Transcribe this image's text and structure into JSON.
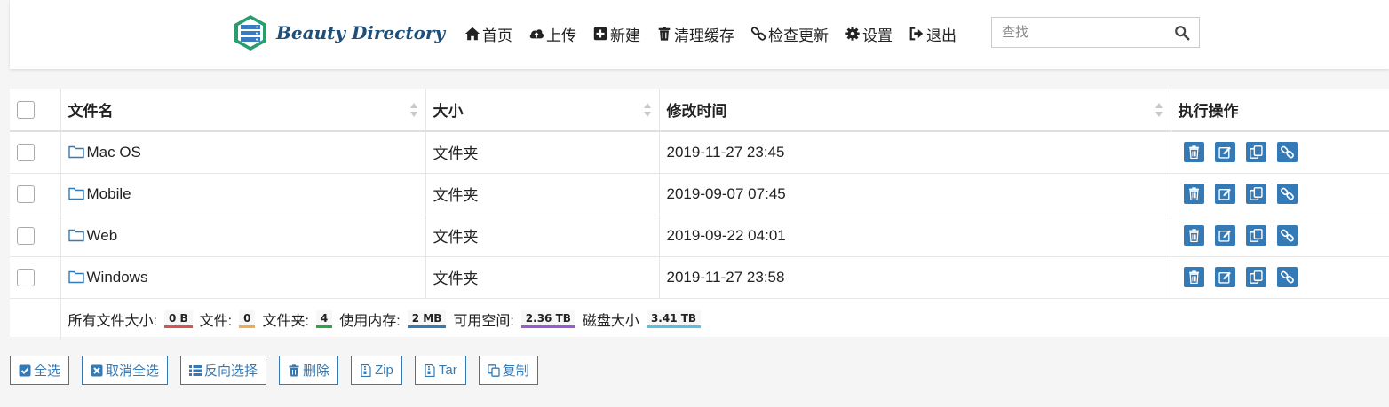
{
  "brand": {
    "name": "Beauty Directory"
  },
  "nav": {
    "items": [
      {
        "label": "首页",
        "icon": "home-icon"
      },
      {
        "label": "上传",
        "icon": "cloud-upload-icon"
      },
      {
        "label": "新建",
        "icon": "plus-square-icon"
      },
      {
        "label": "清理缓存",
        "icon": "trash-icon"
      },
      {
        "label": "检查更新",
        "icon": "link-icon"
      },
      {
        "label": "设置",
        "icon": "gear-icon"
      },
      {
        "label": "退出",
        "icon": "sign-out-icon"
      }
    ],
    "search": {
      "placeholder": "查找",
      "value": ""
    }
  },
  "table": {
    "headers": {
      "name": "文件名",
      "size": "大小",
      "modified": "修改时间",
      "actions": "执行操作"
    },
    "rows": [
      {
        "name": "Mac OS",
        "size": "文件夹",
        "modified": "2019-11-27 23:45"
      },
      {
        "name": "Mobile",
        "size": "文件夹",
        "modified": "2019-09-07 07:45"
      },
      {
        "name": "Web",
        "size": "文件夹",
        "modified": "2019-09-22 04:01"
      },
      {
        "name": "Windows",
        "size": "文件夹",
        "modified": "2019-11-27 23:58"
      }
    ],
    "row_actions": [
      "delete-icon",
      "edit-icon",
      "copy-icon",
      "link-icon"
    ]
  },
  "summary": {
    "total_size_label": "所有文件大小:",
    "total_size": "0 B",
    "files_label": "文件:",
    "files": "0",
    "folders_label": "文件夹:",
    "folders": "4",
    "memory_label": "使用内存:",
    "memory": "2 MB",
    "free_label": "可用空间:",
    "free": "2.36 TB",
    "disk_label": "磁盘大小",
    "disk": "3.41 TB",
    "colors": {
      "total": "#d9534f",
      "files": "#f0ad4e",
      "folders": "#28a745",
      "memory": "#337ab7",
      "free": "#9b59d6",
      "disk": "#5bc0de"
    }
  },
  "bulk_actions": {
    "select_all": "全选",
    "deselect_all": "取消全选",
    "invert": "反向选择",
    "delete": "删除",
    "zip": "Zip",
    "tar": "Tar",
    "copy": "复制"
  },
  "colors": {
    "accent": "#337ab7"
  }
}
